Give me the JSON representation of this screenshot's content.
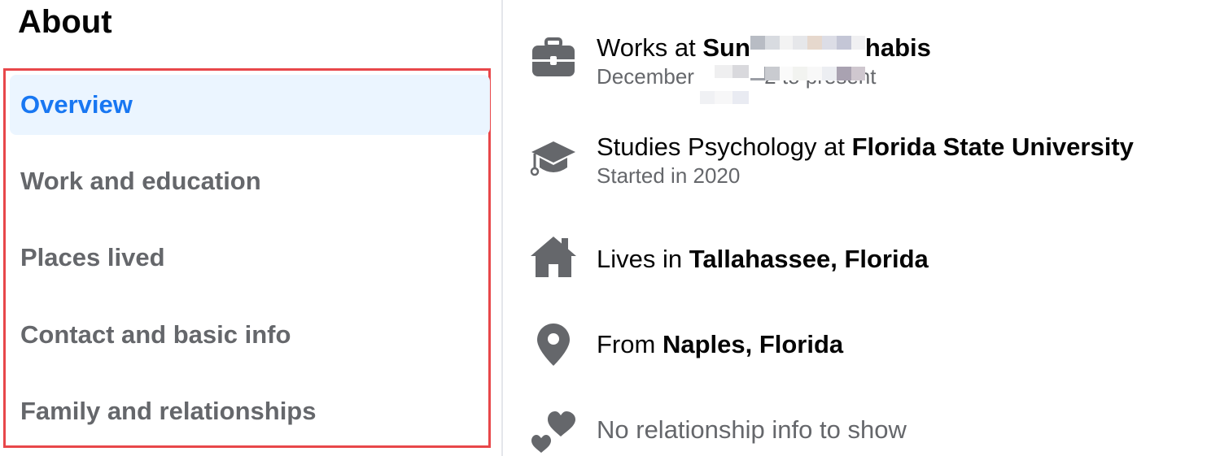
{
  "about": {
    "title": "About",
    "nav": [
      {
        "label": "Overview",
        "active": true
      },
      {
        "label": "Work and education",
        "active": false
      },
      {
        "label": "Places lived",
        "active": false
      },
      {
        "label": "Contact and basic info",
        "active": false
      },
      {
        "label": "Family and relationships",
        "active": false
      }
    ]
  },
  "info": {
    "work": {
      "prefix": "Works at ",
      "employer_start": "Sun",
      "employer_end": "habis",
      "dates_start": "December ",
      "dates_end": "2 to present",
      "icon": "briefcase-icon"
    },
    "education": {
      "prefix": "Studies Psychology at ",
      "school": "Florida State University",
      "started": "Started in 2020",
      "icon": "graduation-cap-icon"
    },
    "lives": {
      "prefix": "Lives in ",
      "place": "Tallahassee, Florida",
      "icon": "home-icon"
    },
    "from": {
      "prefix": "From ",
      "place": "Naples, Florida",
      "icon": "location-pin-icon"
    },
    "relationship": {
      "text": "No relationship info to show",
      "icon": "hearts-icon"
    }
  },
  "colors": {
    "accent": "#1877f2",
    "active_bg": "#ebf5ff",
    "highlight_border": "#e8474a",
    "icon": "#65676b"
  }
}
